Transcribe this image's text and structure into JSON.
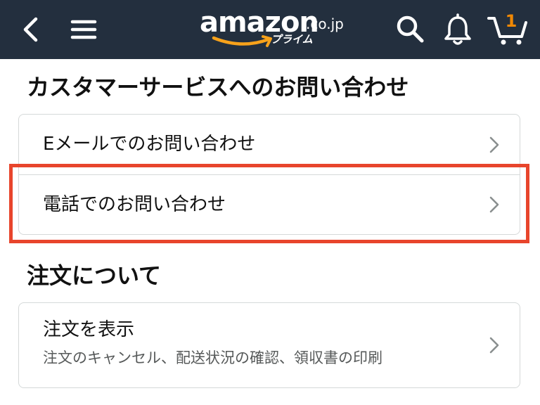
{
  "header": {
    "logo_text": "amazon",
    "logo_domain": ".co.jp",
    "logo_prime": "プライム",
    "cart_count": "1",
    "icons": [
      "back-arrow-icon",
      "hamburger-menu-icon",
      "search-icon",
      "bell-icon",
      "cart-icon"
    ]
  },
  "contact": {
    "title": "カスタマーサービスへのお問い合わせ",
    "items": [
      {
        "label": "Eメールでのお問い合わせ"
      },
      {
        "label": "電話でのお問い合わせ"
      }
    ]
  },
  "orders": {
    "title": "注文について",
    "items": [
      {
        "label": "注文を表示",
        "sub": "注文のキャンセル、配送状況の確認、領収書の印刷"
      }
    ]
  },
  "colors": {
    "header_bg": "#232f3e",
    "highlight": "#e8452c",
    "cart_count": "#f08804",
    "smile": "#f7a21b"
  }
}
